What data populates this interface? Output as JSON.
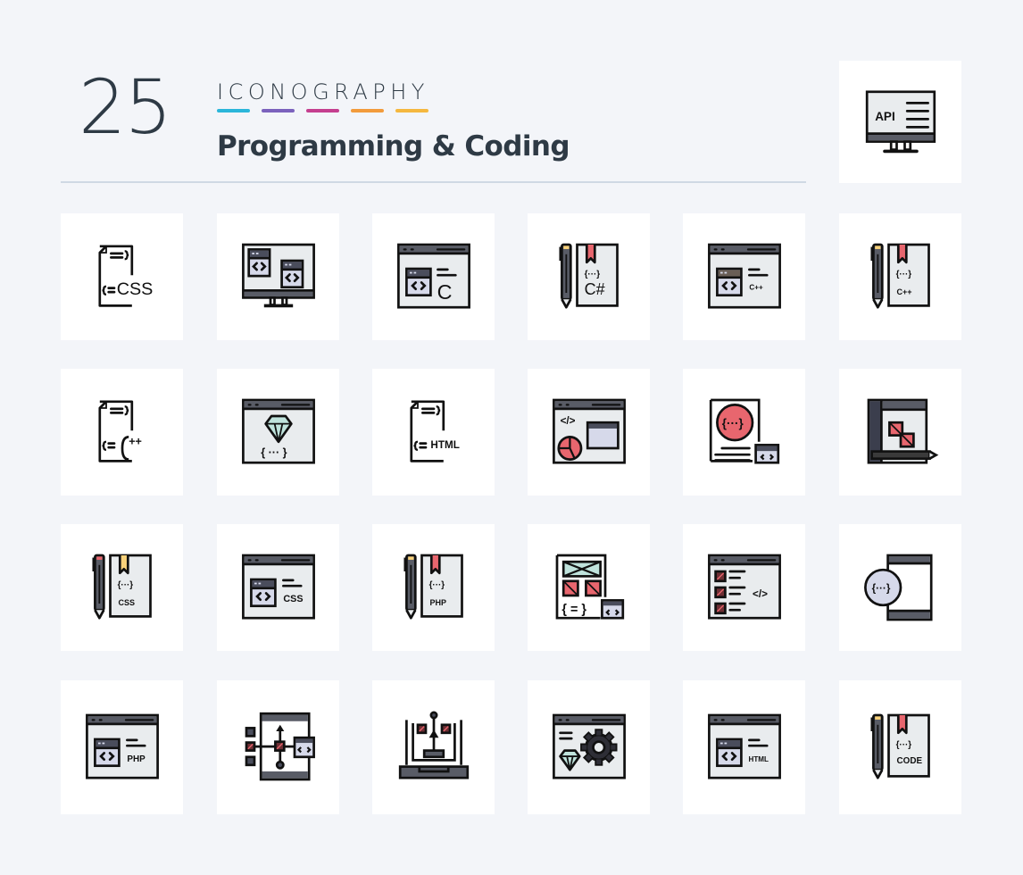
{
  "header": {
    "count": "25",
    "brand": "ICONOGRAPHY",
    "title": "Programming & Coding",
    "accent_colors": [
      "#2bb6da",
      "#7b62bd",
      "#c53f8f",
      "#f29b3c",
      "#f5b83f"
    ]
  },
  "featured_icon": {
    "name": "api-monitor-icon",
    "label": "API"
  },
  "palette": {
    "stroke": "#111111",
    "panel": "#e9ecee",
    "bar": "#595c66",
    "code": "#d6d9ea",
    "red": "#e8666e",
    "yellow": "#f9d27a",
    "mint": "#bfe3dc",
    "navy": "#3b3e4d"
  },
  "icons": [
    {
      "name": "css-file-icon",
      "label": "CSS"
    },
    {
      "name": "monitor-code-windows-icon",
      "label": ""
    },
    {
      "name": "browser-c-icon",
      "label": "C"
    },
    {
      "name": "csharp-book-pencil-icon",
      "label": "C#"
    },
    {
      "name": "browser-cpp-icon",
      "label": "C++"
    },
    {
      "name": "cpp-book-pencil-icon",
      "label": "C++"
    },
    {
      "name": "cpp-file-icon",
      "label": "C++"
    },
    {
      "name": "browser-ruby-gem-icon",
      "label": ""
    },
    {
      "name": "html-file-icon",
      "label": "HTML"
    },
    {
      "name": "browser-pie-chart-icon",
      "label": ""
    },
    {
      "name": "document-code-badge-icon",
      "label": ""
    },
    {
      "name": "design-editor-icon",
      "label": ""
    },
    {
      "name": "css-book-pencil-icon",
      "label": "CSS"
    },
    {
      "name": "browser-css-icon",
      "label": "CSS"
    },
    {
      "name": "php-book-pencil-icon",
      "label": "PHP"
    },
    {
      "name": "wireframe-code-icon",
      "label": ""
    },
    {
      "name": "browser-checklist-code-icon",
      "label": ""
    },
    {
      "name": "mobile-code-icon",
      "label": ""
    },
    {
      "name": "browser-php-icon",
      "label": "PHP"
    },
    {
      "name": "mobile-flowchart-icon",
      "label": ""
    },
    {
      "name": "laptop-flowchart-icon",
      "label": ""
    },
    {
      "name": "browser-gem-gear-icon",
      "label": ""
    },
    {
      "name": "browser-html-icon",
      "label": "HTML"
    },
    {
      "name": "code-book-pencil-icon",
      "label": "CODE"
    }
  ]
}
